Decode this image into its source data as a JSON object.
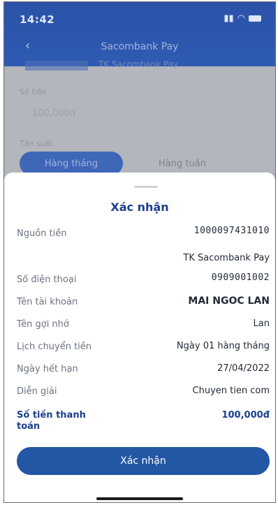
{
  "status_bar": {
    "time": "14:42"
  },
  "background": {
    "nav_title": "Sacombank Pay",
    "back_icon": "back-arrow-icon",
    "sub_text": "TK Sacombank Pay",
    "amount_label": "Số tiền",
    "amount_value": "100,000đ",
    "frequency_label": "Tần suất",
    "chip_monthly": "Hàng tháng",
    "chip_weekly": "Hàng tuần"
  },
  "sheet": {
    "title": "Xác nhận",
    "rows": [
      {
        "label": "Nguồn tiền",
        "value": "1000097431010"
      },
      {
        "label": "",
        "value": "TK Sacombank Pay"
      },
      {
        "label": "Số điện thoại",
        "value": "0909001002"
      },
      {
        "label": "Tên tài khoản",
        "value": "MAI NGOC LAN"
      },
      {
        "label": "Tên gợi nhớ",
        "value": "Lan"
      },
      {
        "label": "Lịch chuyển tiền",
        "value": "Ngày 01 hàng tháng"
      },
      {
        "label": "Ngày hết hạn",
        "value": "27/04/2022"
      },
      {
        "label": "Diễn giải",
        "value": "Chuyen tien com"
      }
    ],
    "total": {
      "label": "Số tiền thanh toán",
      "value": "100,000đ"
    },
    "confirm_button": "Xác nhận"
  },
  "colors": {
    "brand": "#1b3f8c",
    "button": "#2357a4",
    "header": "#2f5bb2"
  }
}
